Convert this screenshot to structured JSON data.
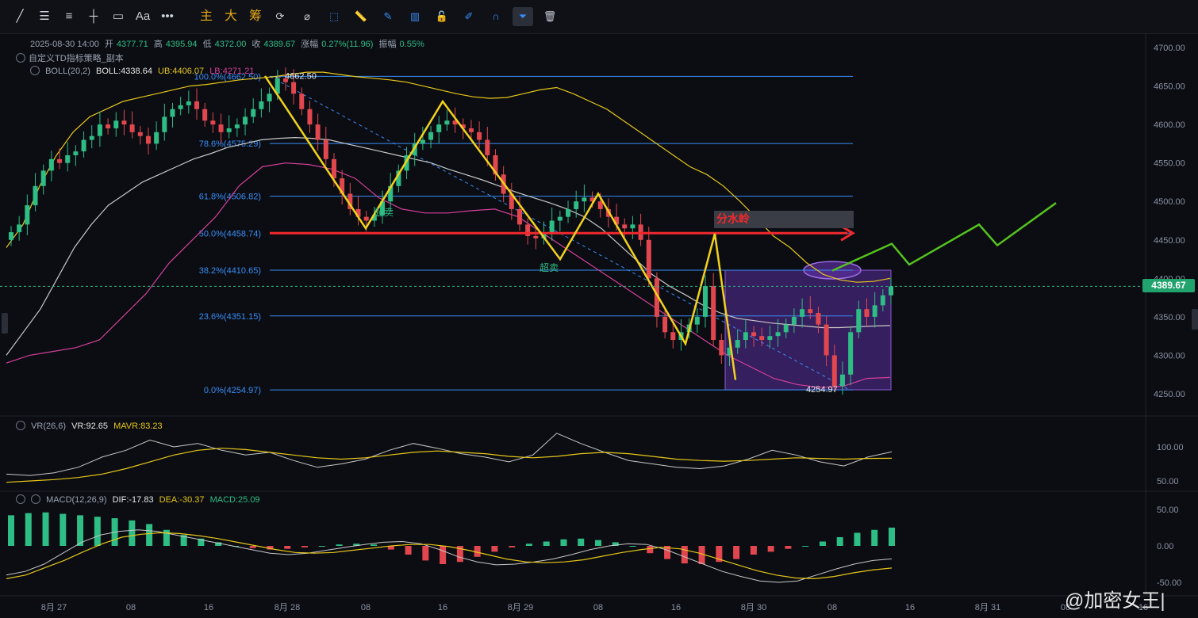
{
  "toolbar": {
    "tools": [
      {
        "name": "trendline-tool-icon",
        "glyph": "╱"
      },
      {
        "name": "fib-tool-icon",
        "glyph": "☰"
      },
      {
        "name": "channel-tool-icon",
        "glyph": "≡"
      },
      {
        "name": "horizontal-line-tool-icon",
        "glyph": "┼"
      },
      {
        "name": "rectangle-tool-icon",
        "glyph": "▭"
      },
      {
        "name": "text-tool-icon",
        "glyph": "Aa"
      },
      {
        "name": "more-tools-icon",
        "glyph": "•••"
      }
    ],
    "cn_buttons": [
      "主",
      "大",
      "筹"
    ],
    "right_tools": [
      {
        "name": "sync-icon",
        "glyph": "⟳"
      },
      {
        "name": "erase-tool-icon",
        "glyph": "⌀"
      },
      {
        "name": "select-tool-icon",
        "glyph": "⬚"
      },
      {
        "name": "ruler-tool-icon",
        "glyph": "📏"
      },
      {
        "name": "brush-tool-icon",
        "glyph": "✎"
      },
      {
        "name": "candle-type-icon",
        "glyph": "▥"
      },
      {
        "name": "lock-icon",
        "glyph": "🔓"
      },
      {
        "name": "note-tool-icon",
        "glyph": "✐"
      },
      {
        "name": "magnet-icon",
        "glyph": "∩"
      },
      {
        "name": "filter-icon",
        "glyph": "⏷"
      },
      {
        "name": "trash-icon",
        "glyph": "🗑"
      }
    ]
  },
  "header": {
    "ohlc": "2025-08-30 14:00",
    "open_label": "开",
    "open": "4377.71",
    "high_label": "高",
    "high": "4395.94",
    "low_label": "低",
    "low": "4372.00",
    "close_label": "收",
    "close": "4389.67",
    "change_label": "涨幅",
    "change": "0.27%(11.96)",
    "amp_label": "振幅",
    "amp": "0.55%",
    "strategy": "自定义TD指标策略_副本",
    "boll_name": "BOLL(20,2)",
    "boll": "BOLL:4338.64",
    "ub": "UB:4406.07",
    "lb": "LB:4271.21",
    "vr_name": "VR(26,6)",
    "vr": "VR:92.65",
    "mavr": "MAVR:83.23",
    "macd_name": "MACD(12,26,9)",
    "dif": "DIF:-17.83",
    "dea": "DEA:-30.37",
    "macd": "MACD:25.09"
  },
  "current_price": "4389.67",
  "watermark": "@加密女王|",
  "colors": {
    "up": "#2ebd85",
    "down": "#e2474f",
    "fib": "#3a8df6",
    "boll_mid": "#c8c8c8",
    "boll_ub": "#e6c619",
    "boll_lb": "#d4409a",
    "zigzag": "#f2d21b",
    "projection": "#55c21e",
    "redline": "#f0282d"
  },
  "chart_data": {
    "type": "candlestick",
    "y_axis": {
      "min": 4250,
      "max": 4700,
      "ticks": [
        4250,
        4300,
        4350,
        4400,
        4450,
        4500,
        4550,
        4600,
        4650,
        4700
      ]
    },
    "x_axis_labels": [
      "8月 27",
      "08",
      "16",
      "8月 28",
      "08",
      "16",
      "8月 29",
      "08",
      "16",
      "8月 30",
      "08",
      "16",
      "8月 31",
      "08",
      "16"
    ],
    "fib_levels": [
      {
        "label": "100.0%(4662.50)",
        "value": 4662.5
      },
      {
        "label": "78.6%(4575.29)",
        "value": 4575.29
      },
      {
        "label": "61.8%(4506.82)",
        "value": 4506.82
      },
      {
        "label": "50.0%(4458.74)",
        "value": 4458.74
      },
      {
        "label": "38.2%(4410.65)",
        "value": 4410.65
      },
      {
        "label": "23.6%(4351.15)",
        "value": 4351.15
      },
      {
        "label": "0.0%(4254.97)",
        "value": 4254.97
      }
    ],
    "annotations": {
      "high_label": "4662.50",
      "low_label": "4254.97",
      "divide_label": "分水岭",
      "oversold": "超卖"
    },
    "closes": [
      4460,
      4470,
      4495,
      4520,
      4540,
      4555,
      4550,
      4560,
      4565,
      4580,
      4585,
      4600,
      4595,
      4605,
      4600,
      4590,
      4585,
      4575,
      4590,
      4610,
      4620,
      4625,
      4630,
      4620,
      4605,
      4600,
      4590,
      4595,
      4600,
      4610,
      4620,
      4630,
      4640,
      4660,
      4655,
      4640,
      4620,
      4600,
      4580,
      4555,
      4530,
      4510,
      4490,
      4480,
      4475,
      4482,
      4500,
      4520,
      4540,
      4560,
      4575,
      4580,
      4590,
      4600,
      4605,
      4600,
      4595,
      4590,
      4580,
      4560,
      4535,
      4510,
      4490,
      4470,
      4455,
      4452,
      4460,
      4475,
      4480,
      4490,
      4500,
      4505,
      4500,
      4490,
      4480,
      4470,
      4465,
      4470,
      4450,
      4400,
      4350,
      4330,
      4320,
      4330,
      4340,
      4350,
      4390,
      4320,
      4300,
      4310,
      4320,
      4330,
      4325,
      4320,
      4325,
      4330,
      4340,
      4350,
      4360,
      4355,
      4340,
      4300,
      4260,
      4275,
      4330,
      4360,
      4350,
      4365,
      4378,
      4389.67
    ],
    "boll_ub": [
      4440,
      4470,
      4520,
      4560,
      4590,
      4610,
      4620,
      4630,
      4635,
      4640,
      4645,
      4650,
      4652,
      4655,
      4658,
      4660,
      4662,
      4665,
      4668,
      4668,
      4665,
      4662,
      4660,
      4658,
      4655,
      4650,
      4645,
      4640,
      4636,
      4634,
      4635,
      4640,
      4645,
      4648,
      4640,
      4630,
      4620,
      4605,
      4590,
      4575,
      4560,
      4545,
      4535,
      4520,
      4500,
      4478,
      4455,
      4440,
      4420,
      4405,
      4398,
      4395,
      4396,
      4400
    ],
    "boll_mid": [
      4300,
      4330,
      4360,
      4400,
      4440,
      4470,
      4495,
      4510,
      4525,
      4535,
      4545,
      4555,
      4562,
      4570,
      4575,
      4580,
      4582,
      4583,
      4582,
      4580,
      4575,
      4570,
      4565,
      4560,
      4555,
      4550,
      4542,
      4535,
      4528,
      4520,
      4512,
      4505,
      4498,
      4490,
      4480,
      4465,
      4445,
      4425,
      4405,
      4390,
      4378,
      4365,
      4355,
      4348,
      4345,
      4342,
      4340,
      4338,
      4336,
      4336,
      4337,
      4338,
      4338.64
    ],
    "boll_lb": [
      4290,
      4300,
      4305,
      4310,
      4320,
      4350,
      4380,
      4420,
      4450,
      4480,
      4520,
      4545,
      4550,
      4548,
      4542,
      4530,
      4505,
      4490,
      4485,
      4485,
      4488,
      4490,
      4480,
      4460,
      4440,
      4420,
      4400,
      4380,
      4360,
      4340,
      4320,
      4300,
      4285,
      4270,
      4262,
      4258,
      4260,
      4270,
      4271.21
    ],
    "zigzag": [
      [
        334,
        4663
      ],
      [
        461,
        4465
      ],
      [
        558,
        4630
      ],
      [
        706,
        4425
      ],
      [
        754,
        4510
      ],
      [
        864,
        4315
      ],
      [
        901,
        4458
      ],
      [
        927,
        4268
      ]
    ],
    "projection": [
      [
        1049,
        4410
      ],
      [
        1124,
        4445
      ],
      [
        1146,
        4418
      ],
      [
        1234,
        4470
      ],
      [
        1257,
        4443
      ],
      [
        1331,
        4498
      ]
    ],
    "vr": [
      60,
      58,
      62,
      70,
      85,
      95,
      110,
      100,
      105,
      95,
      88,
      92,
      80,
      70,
      75,
      82,
      95,
      105,
      98,
      90,
      85,
      78,
      88,
      120,
      105,
      92,
      80,
      75,
      70,
      68,
      72,
      82,
      95,
      88,
      78,
      72,
      85,
      92.65
    ],
    "mavr": [
      48,
      50,
      52,
      55,
      60,
      68,
      78,
      88,
      95,
      98,
      96,
      92,
      88,
      84,
      82,
      84,
      88,
      92,
      94,
      92,
      90,
      86,
      84,
      86,
      90,
      92,
      90,
      86,
      82,
      80,
      79,
      80,
      82,
      84,
      83,
      82,
      83,
      83.23
    ],
    "macd_hist": [
      42,
      45,
      46,
      44,
      42,
      40,
      38,
      35,
      30,
      22,
      15,
      10,
      5,
      0,
      -3,
      -5,
      -4,
      -2,
      0,
      2,
      3,
      2,
      -5,
      -12,
      -20,
      -25,
      -22,
      -15,
      -8,
      -2,
      3,
      6,
      9,
      10,
      8,
      5,
      0,
      -10,
      -18,
      -24,
      -25,
      -22,
      -18,
      -12,
      -8,
      -4,
      0,
      6,
      12,
      18,
      22,
      25.09
    ],
    "dif": [
      -40,
      -35,
      -25,
      -10,
      5,
      15,
      20,
      22,
      20,
      15,
      10,
      5,
      0,
      -5,
      -10,
      -12,
      -10,
      -6,
      -2,
      2,
      5,
      6,
      3,
      -5,
      -15,
      -22,
      -26,
      -25,
      -22,
      -18,
      -12,
      -5,
      0,
      3,
      2,
      -5,
      -15,
      -25,
      -35,
      -42,
      -48,
      -50,
      -48,
      -40,
      -32,
      -25,
      -20,
      -17.83
    ],
    "dea": [
      -45,
      -40,
      -30,
      -20,
      -8,
      3,
      12,
      16,
      18,
      17,
      14,
      10,
      5,
      0,
      -5,
      -9,
      -10,
      -9,
      -6,
      -3,
      0,
      2,
      2,
      -1,
      -6,
      -12,
      -18,
      -22,
      -23,
      -22,
      -19,
      -14,
      -9,
      -5,
      -2,
      -4,
      -10,
      -18,
      -26,
      -34,
      -40,
      -44,
      -45,
      -42,
      -37,
      -33,
      -30.37
    ]
  }
}
